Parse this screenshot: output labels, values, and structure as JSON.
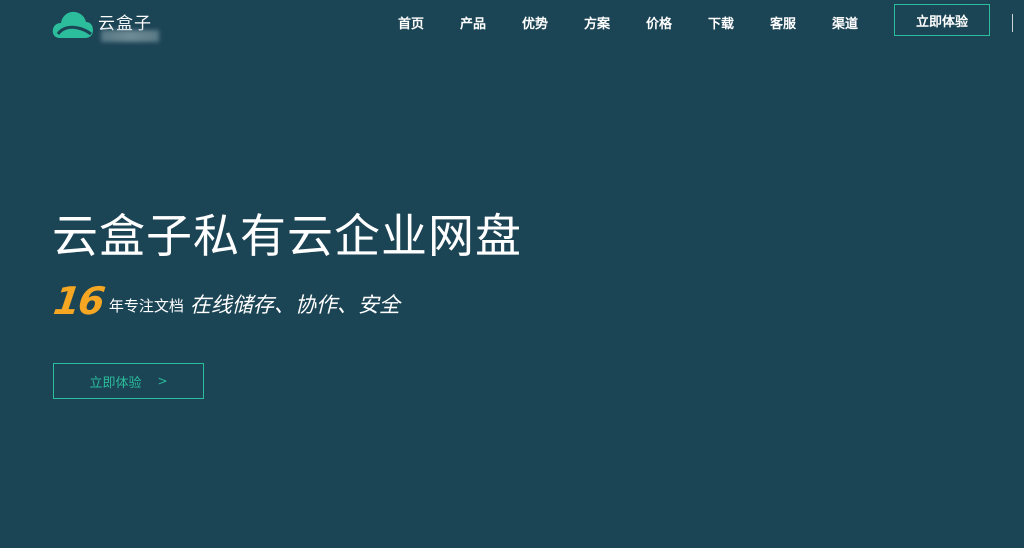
{
  "header": {
    "logo_text": "云盒子",
    "nav": [
      {
        "label": "首页"
      },
      {
        "label": "产品"
      },
      {
        "label": "优势"
      },
      {
        "label": "方案"
      },
      {
        "label": "价格"
      },
      {
        "label": "下载"
      },
      {
        "label": "客服"
      },
      {
        "label": "渠道"
      }
    ],
    "cta_label": "立即体验"
  },
  "hero": {
    "title": "云盒子私有云企业网盘",
    "years": "16",
    "years_suffix": "年专注文档",
    "tagline": "在线储存、协作、安全",
    "cta_label": "立即体验",
    "cta_chevron": ">"
  },
  "colors": {
    "background": "#1b4455",
    "accent": "#2bbd9c",
    "highlight": "#f5a623"
  },
  "icons": {
    "logo": "cloud-icon"
  }
}
